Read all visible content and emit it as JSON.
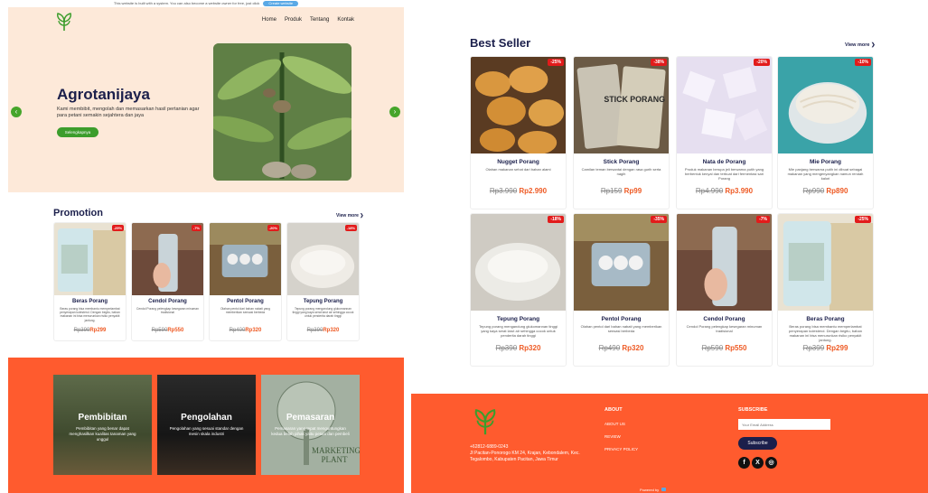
{
  "topbar": {
    "note": "This website is built with a system. You can also become a website owner for free, just click",
    "button": "Create website"
  },
  "nav": {
    "items": [
      "Home",
      "Produk",
      "Tentang",
      "Kontak"
    ]
  },
  "hero": {
    "title": "Agrotanijaya",
    "desc": "Kami membibit, mengolah dan memasarkan hasil pertanian agar para petani semakin sejahtera dan jaya",
    "button": "Selengkapnya",
    "prev_icon": "chevron-left-icon",
    "next_icon": "chevron-right-icon"
  },
  "promotion": {
    "title": "Promotion",
    "view_more": "View more ❯",
    "items": [
      {
        "name": "Beras Porang",
        "badge": "-25%",
        "desc": "Beras porang bisa membantu memperlambat penyerapan kolesterol. Dengan begitu, bahan makanan ini bisa menurunkan risiko penyakit jantung.",
        "old": "Rp399",
        "new": "Rp299"
      },
      {
        "name": "Cendol Porang",
        "badge": "-7%",
        "desc": "Cendol Porang pelengkap kesegaran minuman tradisional",
        "old": "Rp590",
        "new": "Rp550"
      },
      {
        "name": "Pentol Porang",
        "badge": "-20%",
        "desc": "Olahan pentol dari bahan nabati yang memberikan sensasi berbeda",
        "old": "Rp400",
        "new": "Rp320"
      },
      {
        "name": "Tepung Porang",
        "badge": "-18%",
        "desc": "Tepung porang mengandung glukomannan tinggi yang kaya serat larut air sehingga cocok untuk penderita darah tinggi",
        "old": "Rp390",
        "new": "Rp320"
      }
    ]
  },
  "services": [
    {
      "title": "Pembibitan",
      "desc": "Pembibitan yang benar dapat menghasilkan kualitas tanaman yang unggul"
    },
    {
      "title": "Pengolahan",
      "desc": "Pengolahan yang sesuai standar dengan mesin skala industri"
    },
    {
      "title": "Pemasaran",
      "desc": "Pemasaran yang tepat menguntungkan kedua belah pihak yaitu petani dan pembeli",
      "image_text": [
        "MARKETING",
        "PLANT"
      ]
    }
  ],
  "bestseller": {
    "title": "Best Seller",
    "view_more": "View more ❯",
    "items": [
      {
        "name": "Nugget Porang",
        "badge": "-25%",
        "desc": "Olahan makanan sehat dari bahan alami",
        "old": "Rp3.990",
        "new": "Rp2.990"
      },
      {
        "name": "Stick Porang",
        "badge": "-38%",
        "desc": "Camilan teman bersantai dengan rasa gurih serta nagih",
        "old": "Rp159",
        "new": "Rp99",
        "image_text": "STICK PORANG"
      },
      {
        "name": "Nata de Porang",
        "badge": "-20%",
        "desc": "Produk makanan berupa jeli berwarna putih yang berbentuk kenyal dan terbuat dari fermentasi sari Porang",
        "old": "Rp4.990",
        "new": "Rp3.990"
      },
      {
        "name": "Mie Porang",
        "badge": "-10%",
        "desc": "Mie panjang berwarna putih ini dibuat sebagai makanan yang mengenyangkan namun rendah kalori",
        "old": "Rp990",
        "new": "Rp890"
      },
      {
        "name": "Tepung Porang",
        "badge": "-18%",
        "desc": "Tepung porang mengandung glukomannan tinggi yang kaya serat larut air sehingga cocok untuk penderita darah tinggi",
        "old": "Rp390",
        "new": "Rp320"
      },
      {
        "name": "Pentol Porang",
        "badge": "-35%",
        "desc": "Olahan pentol dari bahan nabati yang memberikan sensasi berbeda",
        "old": "Rp490",
        "new": "Rp320"
      },
      {
        "name": "Cendol Porang",
        "badge": "-7%",
        "desc": "Cendol Porang pelengkap kesegaran minuman tradisional",
        "old": "Rp590",
        "new": "Rp550"
      },
      {
        "name": "Beras Porang",
        "badge": "-25%",
        "desc": "Beras porang bisa membantu memperlambat penyerapan kolesterol. Dengan begitu, bahan makanan ini bisa menurunkan risiko penyakit jantung.",
        "old": "Rp399",
        "new": "Rp299"
      }
    ]
  },
  "footer": {
    "phone": "+62812-6889-0243",
    "address": "Jl Pacitan-Ponorogo KM 24, Krajan, Kebondalem, Kec. Tegalombo, Kabupaten Pacitan, Jawa Timur",
    "about_head": "ABOUT",
    "links": [
      "ABOUT US",
      "REVIEW",
      "PRIVACY POLICY"
    ],
    "subscribe_head": "SUBSCRIBE",
    "email_placeholder": "Your Email Address",
    "subscribe_button": "Subscribe",
    "social": [
      "f",
      "X",
      "◎"
    ],
    "powered": "Powered by"
  },
  "colors": {
    "accent_orange": "#ff5b2e",
    "navy": "#1b1f4b",
    "green": "#3c9d2c",
    "badge_red": "#e21b1b"
  }
}
